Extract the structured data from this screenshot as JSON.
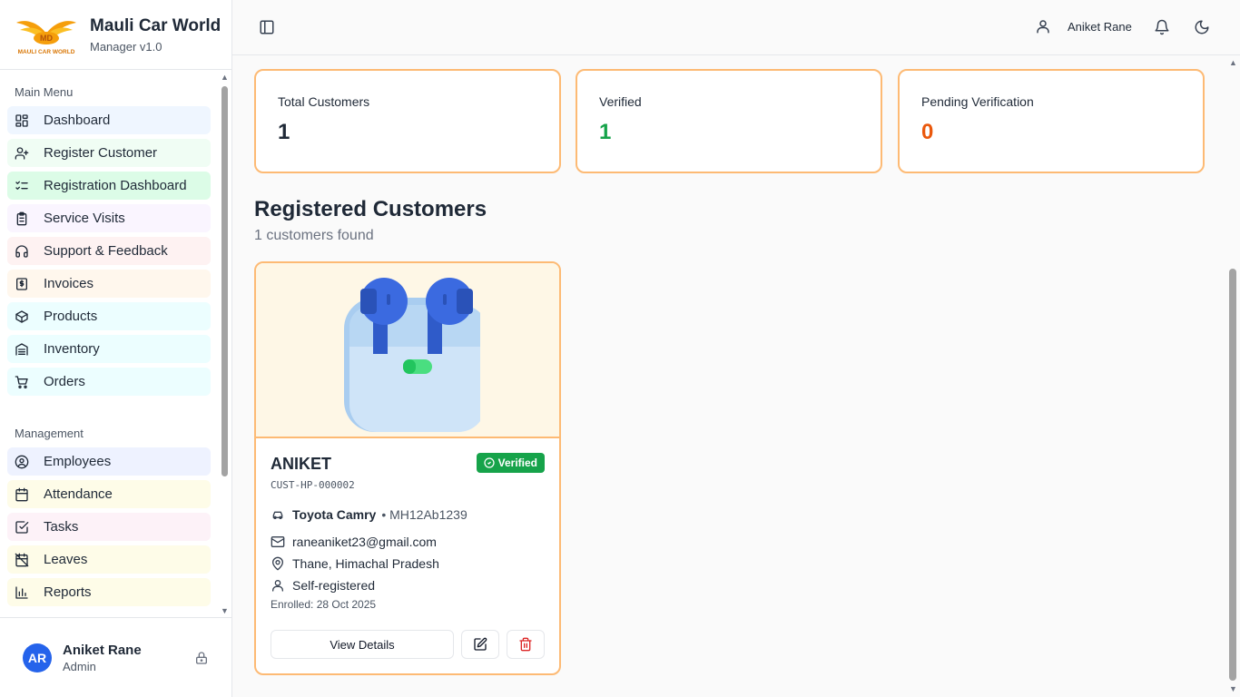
{
  "brand": {
    "title": "Mauli Car World",
    "subtitle": "Manager v1.0",
    "logo_text": "MAULI CAR WORLD",
    "logo_initials": "MD"
  },
  "sidebar": {
    "main_menu_label": "Main Menu",
    "main_items": [
      {
        "label": "Dashboard",
        "icon": "dashboard-icon",
        "bg": "#eff6ff"
      },
      {
        "label": "Register Customer",
        "icon": "user-plus-icon",
        "bg": "#f0fdf4"
      },
      {
        "label": "Registration Dashboard",
        "icon": "list-checks-icon",
        "bg": "#dcfce7"
      },
      {
        "label": "Service Visits",
        "icon": "clipboard-icon",
        "bg": "#faf5ff"
      },
      {
        "label": "Support & Feedback",
        "icon": "headset-icon",
        "bg": "#fef2f2"
      },
      {
        "label": "Invoices",
        "icon": "invoice-icon",
        "bg": "#fff7ed"
      },
      {
        "label": "Products",
        "icon": "package-icon",
        "bg": "#ecfeff"
      },
      {
        "label": "Inventory",
        "icon": "warehouse-icon",
        "bg": "#ecfeff"
      },
      {
        "label": "Orders",
        "icon": "cart-icon",
        "bg": "#ecfeff"
      }
    ],
    "management_label": "Management",
    "management_items": [
      {
        "label": "Employees",
        "icon": "user-circle-icon",
        "bg": "#eef2ff"
      },
      {
        "label": "Attendance",
        "icon": "calendar-icon",
        "bg": "#fefce8"
      },
      {
        "label": "Tasks",
        "icon": "checkbox-icon",
        "bg": "#fdf2f8"
      },
      {
        "label": "Leaves",
        "icon": "calendar-off-icon",
        "bg": "#fefce8"
      },
      {
        "label": "Reports",
        "icon": "bar-chart-icon",
        "bg": "#fefce8"
      }
    ]
  },
  "user": {
    "initials": "AR",
    "name": "Aniket Rane",
    "role": "Admin"
  },
  "header": {
    "user_name": "Aniket Rane"
  },
  "stats": [
    {
      "label": "Total Customers",
      "value": "1",
      "color": "#1f2937"
    },
    {
      "label": "Verified",
      "value": "1",
      "color": "#16a34a"
    },
    {
      "label": "Pending Verification",
      "value": "0",
      "color": "#ea580c"
    }
  ],
  "section": {
    "title": "Registered Customers",
    "count_text": "1 customers found"
  },
  "customer": {
    "name": "ANIKET",
    "id": "CUST-HP-000002",
    "status": "Verified",
    "vehicle_model": "Toyota Camry",
    "plate": "• MH12Ab1239",
    "email": "raneaniket23@gmail.com",
    "location": "Thane, Himachal Pradesh",
    "source": "Self-registered",
    "enrolled": "Enrolled: 28 Oct 2025",
    "view_label": "View Details"
  },
  "colors": {
    "accent_border": "#fdba74",
    "verified": "#16a34a",
    "pending": "#ea580c",
    "delete": "#dc2626"
  }
}
